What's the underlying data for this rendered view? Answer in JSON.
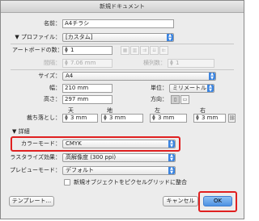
{
  "window": {
    "title": "新規ドキュメント"
  },
  "name": {
    "label": "名前：",
    "value": "A4チラシ"
  },
  "profile": {
    "label": "プロファイル：",
    "value": "[カスタム]"
  },
  "artboards": {
    "count_label": "アートボードの数：",
    "count_value": "1",
    "spacing_label": "間隔：",
    "spacing_value": "7.06 mm",
    "columns_label": "横列数：",
    "columns_value": "1"
  },
  "size": {
    "label": "サイズ：",
    "value": "A4"
  },
  "width": {
    "label": "幅：",
    "value": "210 mm"
  },
  "units": {
    "label": "単位：",
    "value": "ミリメートル"
  },
  "height": {
    "label": "高さ：",
    "value": "297 mm"
  },
  "orientation": {
    "label": "方向："
  },
  "bleed": {
    "label": "裁ち落とし：",
    "top_label": "天",
    "top_value": "3 mm",
    "bottom_label": "地",
    "bottom_value": "3 mm",
    "left_label": "左",
    "left_value": "3 mm",
    "right_label": "右",
    "right_value": "3 mm"
  },
  "advanced": {
    "toggle_label": "詳細",
    "color_mode_label": "カラーモード：",
    "color_mode_value": "CMYK",
    "raster_label": "ラスタライズ効果：",
    "raster_value": "高解像度 (300 ppi)",
    "preview_label": "プレビューモード：",
    "preview_value": "デフォルト",
    "pixel_grid_label": "新規オブジェクトをピクセルグリッドに整合"
  },
  "buttons": {
    "templates": "テンプレート...",
    "cancel": "キャンセル",
    "ok": "OK"
  },
  "colors": {
    "highlight": "#e02020",
    "accent": "#3b84e0"
  }
}
